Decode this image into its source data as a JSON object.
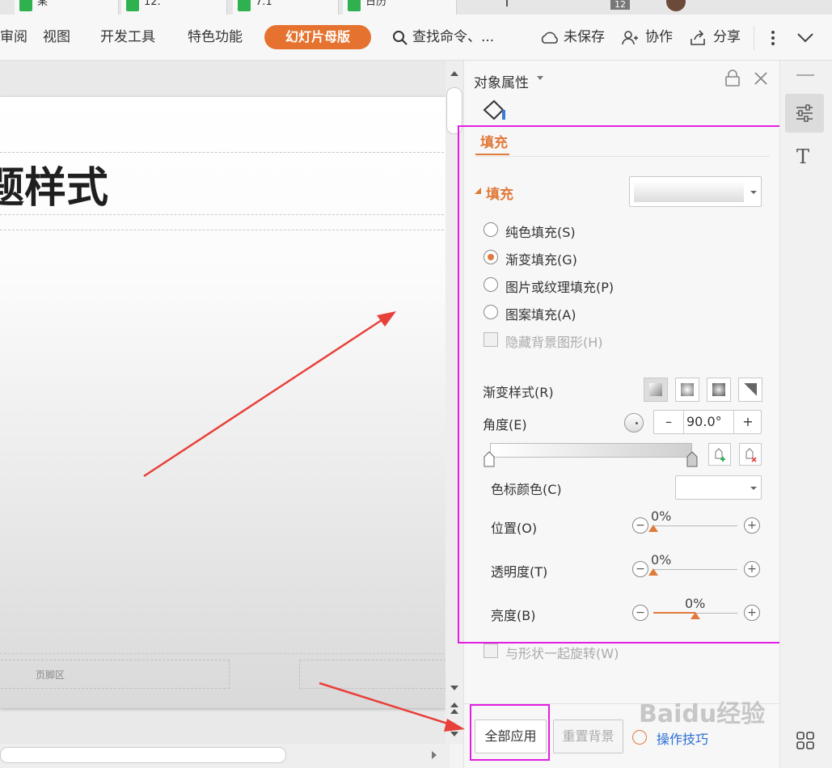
{
  "tabs": [
    {
      "label": "某"
    },
    {
      "label": "12."
    },
    {
      "label": "7.1"
    },
    {
      "label": "日历"
    }
  ],
  "tab_badge": "12",
  "menu": {
    "review": "审阅",
    "view": "视图",
    "dev_tools": "开发工具",
    "special": "特色功能",
    "slide_master": "幻灯片母版",
    "search": "查找命令、...",
    "unsaved": "未保存",
    "collab": "协作",
    "share": "分享"
  },
  "slide": {
    "title_fragment": "题样式",
    "footer_label": "页脚区"
  },
  "panel": {
    "title": "对象属性",
    "tab_fill": "填充",
    "section_fill": "填充",
    "options": [
      {
        "label": "纯色填充(S)",
        "selected": false
      },
      {
        "label": "渐变填充(G)",
        "selected": true
      },
      {
        "label": "图片或纹理填充(P)",
        "selected": false
      },
      {
        "label": "图案填充(A)",
        "selected": false
      }
    ],
    "hide_bg": "隐藏背景图形(H)",
    "gradient_style": "渐变样式(R)",
    "angle_label": "角度(E)",
    "angle_value": "90.0°",
    "stop_color": "色标颜色(C)",
    "position_label": "位置(O)",
    "position_value": "0%",
    "position_level": 0,
    "transparency_label": "透明度(T)",
    "transparency_value": "0%",
    "transparency_level": 0,
    "brightness_label": "亮度(B)",
    "brightness_value": "0%",
    "brightness_level": 0.5,
    "rotate_with_shape": "与形状一起旋转(W)",
    "apply_all": "全部应用",
    "reset_bg": "重置背景",
    "tips": "操作技巧"
  },
  "watermark": "Baidu经验",
  "colors": {
    "accent": "#e5732f",
    "highlight": "#e31ee3",
    "arrow": "#e8403a"
  }
}
